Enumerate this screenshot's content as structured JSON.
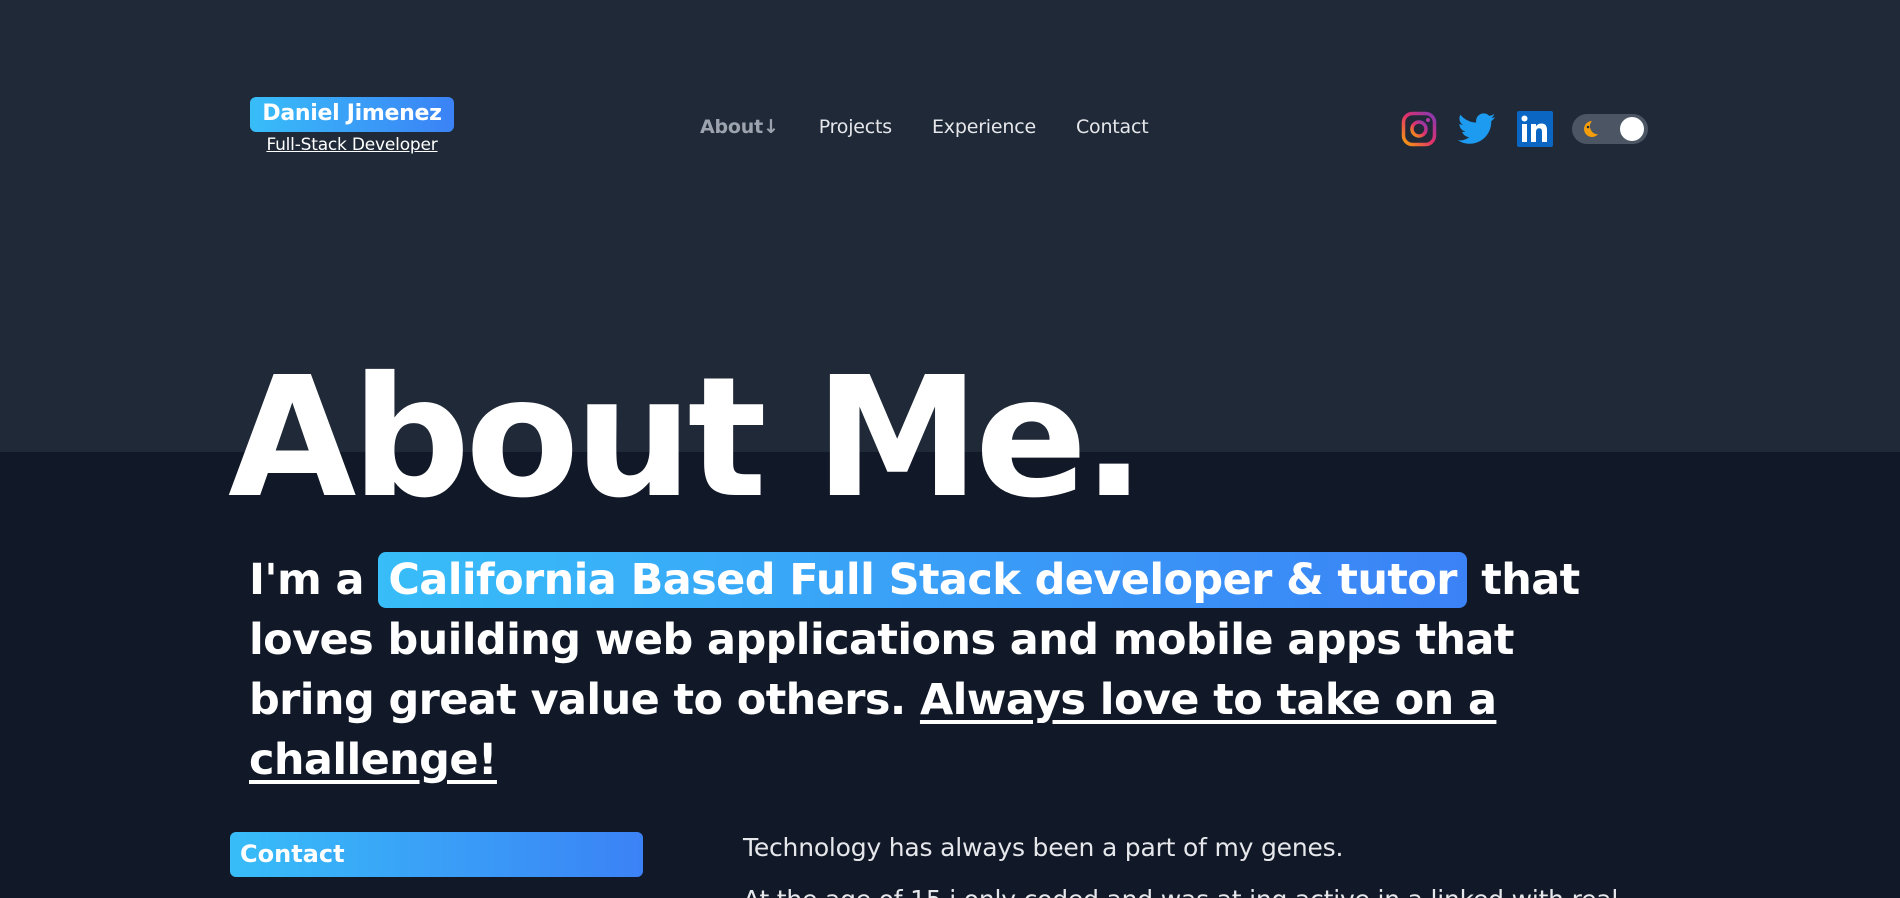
{
  "header": {
    "brand_name": "Daniel Jimenez",
    "brand_subtitle": "Full-Stack Developer",
    "nav": [
      {
        "label": "About↓",
        "active": true
      },
      {
        "label": "Projects",
        "active": false
      },
      {
        "label": "Experience",
        "active": false
      },
      {
        "label": "Contact",
        "active": false
      }
    ],
    "social_icons": [
      "instagram-icon",
      "twitter-icon",
      "linkedin-icon"
    ],
    "theme_toggle": {
      "icon": "moon-icon",
      "state": "dark"
    }
  },
  "hero": {
    "title": "About Me.",
    "intro_prefix": "I'm a",
    "intro_highlight": "California Based Full Stack developer & tutor",
    "intro_rest": "that loves building web applications and mobile apps that bring great value to others.",
    "intro_link": "Always love to take on a challenge!"
  },
  "sidebar": {
    "contact_label": "Contact"
  },
  "body": {
    "paragraph_1": "Technology has always been a part of my genes.",
    "paragraph_2": "At the age of 15 i only coded and was at ing active in a linked with real"
  },
  "colors": {
    "page_bg": "#111827",
    "top_band_bg": "#1f2937",
    "gradient_start": "#38bdf8",
    "gradient_end": "#3b82f6",
    "twitter": "#1d9bf0",
    "linkedin": "#0a66c2"
  }
}
